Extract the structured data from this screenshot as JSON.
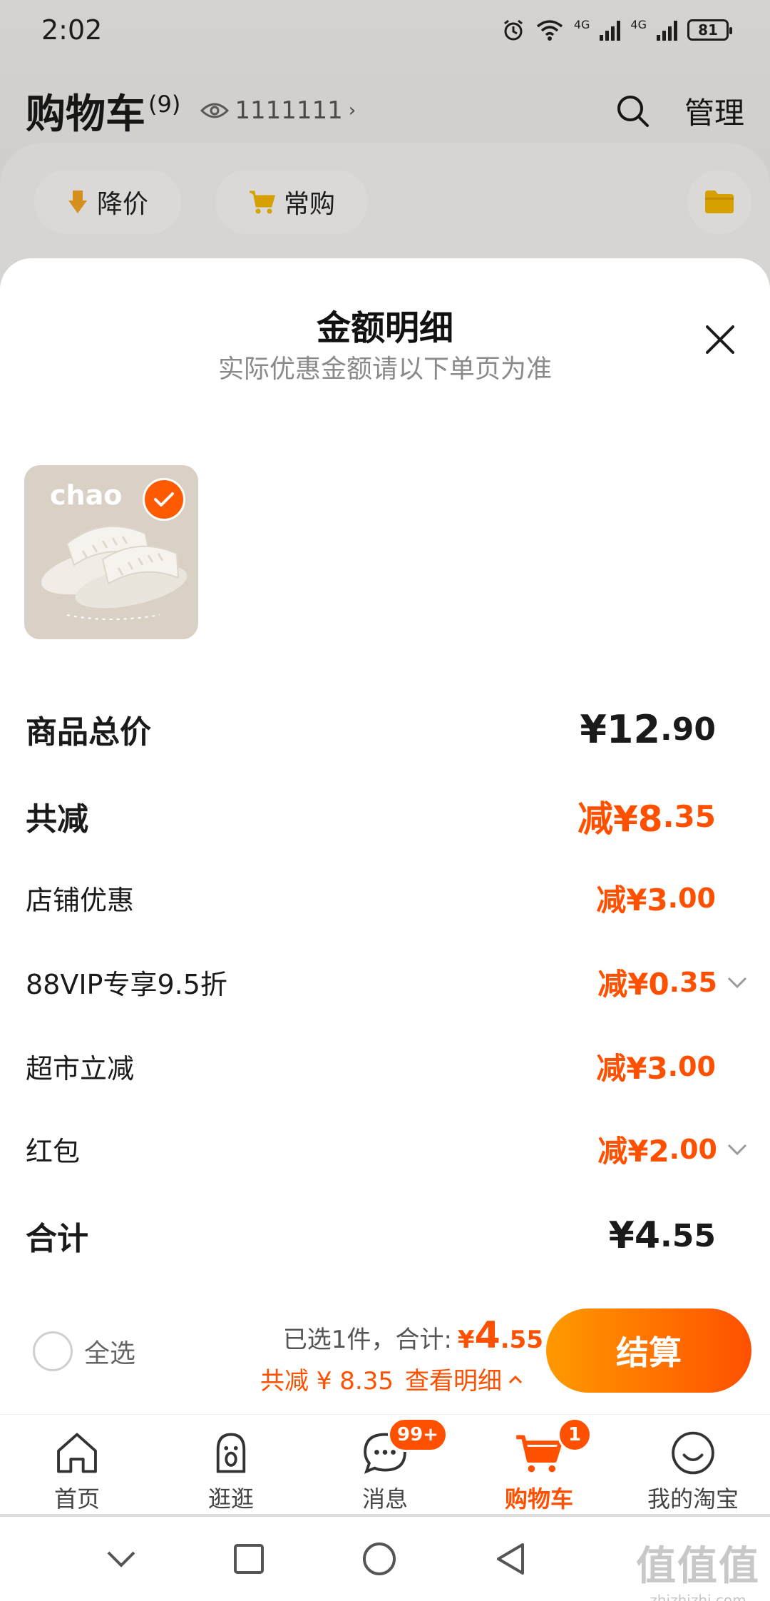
{
  "status_bar": {
    "time": "2:02",
    "network_1": "4G",
    "network_2": "4G",
    "battery": "81"
  },
  "cart_page": {
    "title": "购物车",
    "count": "(9)",
    "viewer_id": "1111111",
    "manage_label": "管理",
    "chips": [
      {
        "label": "降价",
        "icon": "price-drop-icon"
      },
      {
        "label": "常购",
        "icon": "frequent-cart-icon"
      }
    ]
  },
  "sheet": {
    "title": "金额明细",
    "subtitle": "实际优惠金额请以下单页为准",
    "product": {
      "brand_text": "chao",
      "selected": true
    },
    "rows": [
      {
        "label": "商品总价",
        "value_main": "¥12",
        "value_dec": ".90",
        "style": "total"
      },
      {
        "label": "共减",
        "value_main": "减¥8",
        "value_dec": ".35",
        "style": "discount-total"
      },
      {
        "label": "店铺优惠",
        "value_main": "减¥3",
        "value_dec": ".00",
        "style": "discount"
      },
      {
        "label": "88VIP专享9.5折",
        "value_main": "减¥0",
        "value_dec": ".35",
        "style": "discount",
        "expandable": true
      },
      {
        "label": "超市立减",
        "value_main": "减¥3",
        "value_dec": ".00",
        "style": "discount"
      },
      {
        "label": "红包",
        "value_main": "减¥2",
        "value_dec": ".00",
        "style": "discount",
        "expandable": true
      },
      {
        "label": "合计",
        "value_main": "¥4",
        "value_dec": ".55",
        "style": "sum"
      }
    ]
  },
  "checkout": {
    "select_all_label": "全选",
    "selected_text": "已选1件，合计:",
    "currency": "¥",
    "total_main": "4",
    "total_dec": ".55",
    "saved_text": "共减 ¥ 8.35",
    "details_link": "查看明细",
    "checkout_label": "结算"
  },
  "tabs": [
    {
      "label": "首页",
      "icon": "home-icon"
    },
    {
      "label": "逛逛",
      "icon": "browse-icon"
    },
    {
      "label": "消息",
      "icon": "message-icon",
      "badge": "99+"
    },
    {
      "label": "购物车",
      "icon": "cart-icon",
      "badge": "1",
      "active": true
    },
    {
      "label": "我的淘宝",
      "icon": "profile-icon"
    }
  ],
  "colors": {
    "accent": "#ff5000",
    "accent_light": "#ff9a00"
  },
  "watermark": {
    "main": "值值值",
    "sub": "zhizhizhi.com"
  }
}
